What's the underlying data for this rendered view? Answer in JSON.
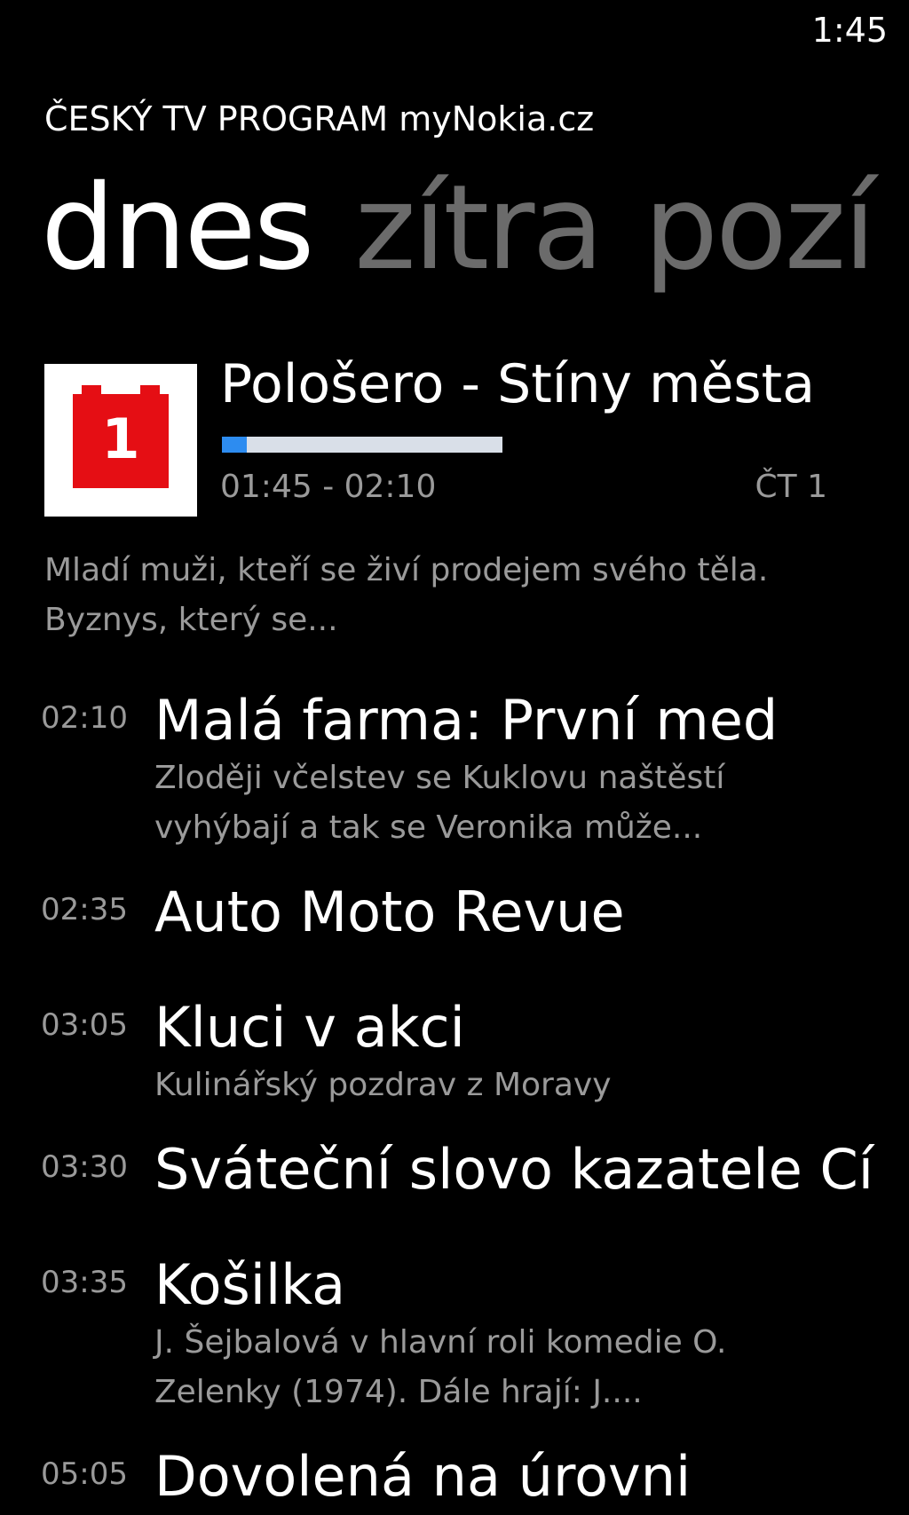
{
  "status": {
    "time": "1:45"
  },
  "app": {
    "title": "ČESKÝ TV PROGRAM myNokia.cz"
  },
  "pivot": {
    "tabs": [
      {
        "label": "dnes",
        "active": true
      },
      {
        "label": "zítra",
        "active": false
      },
      {
        "label": "pozí",
        "active": false
      }
    ]
  },
  "now_playing": {
    "channel_logo_text": "1",
    "title": "Pološero - Stíny města",
    "progress_fraction": 0.09,
    "time_range": "01:45 - 02:10",
    "channel": "ČT 1",
    "description": "Mladí muži, kteří se živí prodejem svého těla. Byznys, který se..."
  },
  "programs": [
    {
      "time": "02:10",
      "title": "Malá farma: První med",
      "desc": "Zloději včelstev se Kuklovu naštěstí vyhýbají a tak se Veronika může..."
    },
    {
      "time": "02:35",
      "title": "Auto Moto Revue",
      "desc": ""
    },
    {
      "time": "03:05",
      "title": "Kluci v akci",
      "desc": "Kulinářský pozdrav z Moravy"
    },
    {
      "time": "03:30",
      "title": "Sváteční slovo kazatele Círk",
      "desc": ""
    },
    {
      "time": "03:35",
      "title": "Košilka",
      "desc": "J. Šejbalová v hlavní roli komedie O. Zelenky (1974). Dále hrají: J...."
    },
    {
      "time": "05:05",
      "title": "Dovolená na úrovni",
      "desc": ""
    }
  ],
  "colors": {
    "accent": "#2d8cf0",
    "channel_red": "#e50e14",
    "inactive": "#6b6b6b"
  }
}
